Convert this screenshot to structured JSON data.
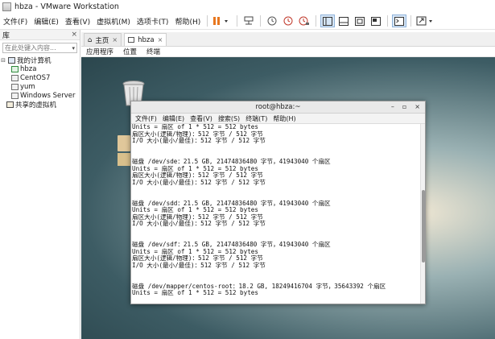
{
  "window": {
    "title": "hbza - VMware Workstation"
  },
  "menubar": {
    "items": [
      "文件(F)",
      "编辑(E)",
      "查看(V)",
      "虚拟机(M)",
      "选项卡(T)",
      "帮助(H)"
    ]
  },
  "library": {
    "title": "库",
    "close": "×",
    "search_placeholder": "在此处键入内容...",
    "tree": [
      {
        "label": "我的计算机",
        "level": 0
      },
      {
        "label": "hbza",
        "level": 1
      },
      {
        "label": "CentOS7",
        "level": 1
      },
      {
        "label": "yum",
        "level": 1
      },
      {
        "label": "Windows Server",
        "level": 1
      },
      {
        "label": "共享的虚拟机",
        "level": 0
      }
    ]
  },
  "tabs": [
    {
      "label": "主页",
      "active": false
    },
    {
      "label": "hbza",
      "active": true
    }
  ],
  "guest_topbar": {
    "items": [
      "应用程序",
      "位置",
      "终端"
    ]
  },
  "terminal": {
    "title": "root@hbza:~",
    "menu": [
      "文件(F)",
      "编辑(E)",
      "查看(V)",
      "搜索(S)",
      "终端(T)",
      "帮助(H)"
    ],
    "lines": [
      "Units = 扇区 of 1 * 512 = 512 bytes",
      "扇区大小(逻辑/物理)：512 字节 / 512 字节",
      "I/O 大小(最小/最佳)：512 字节 / 512 字节",
      "",
      "",
      "磁盘 /dev/sde：21.5 GB, 21474836480 字节，41943040 个扇区",
      "Units = 扇区 of 1 * 512 = 512 bytes",
      "扇区大小(逻辑/物理)：512 字节 / 512 字节",
      "I/O 大小(最小/最佳)：512 字节 / 512 字节",
      "",
      "",
      "磁盘 /dev/sdd：21.5 GB, 21474836480 字节，41943040 个扇区",
      "Units = 扇区 of 1 * 512 = 512 bytes",
      "扇区大小(逻辑/物理)：512 字节 / 512 字节",
      "I/O 大小(最小/最佳)：512 字节 / 512 字节",
      "",
      "",
      "磁盘 /dev/sdf：21.5 GB, 21474836480 字节，41943040 个扇区",
      "Units = 扇区 of 1 * 512 = 512 bytes",
      "扇区大小(逻辑/物理)：512 字节 / 512 字节",
      "I/O 大小(最小/最佳)：512 字节 / 512 字节",
      "",
      "",
      "磁盘 /dev/mapper/centos-root：18.2 GB, 18249416704 字节，35643392 个扇区",
      "Units = 扇区 of 1 * 512 = 512 bytes"
    ]
  },
  "colors": {
    "pause_orange": "#e8771f",
    "accent_blue": "#2f6fb5"
  }
}
